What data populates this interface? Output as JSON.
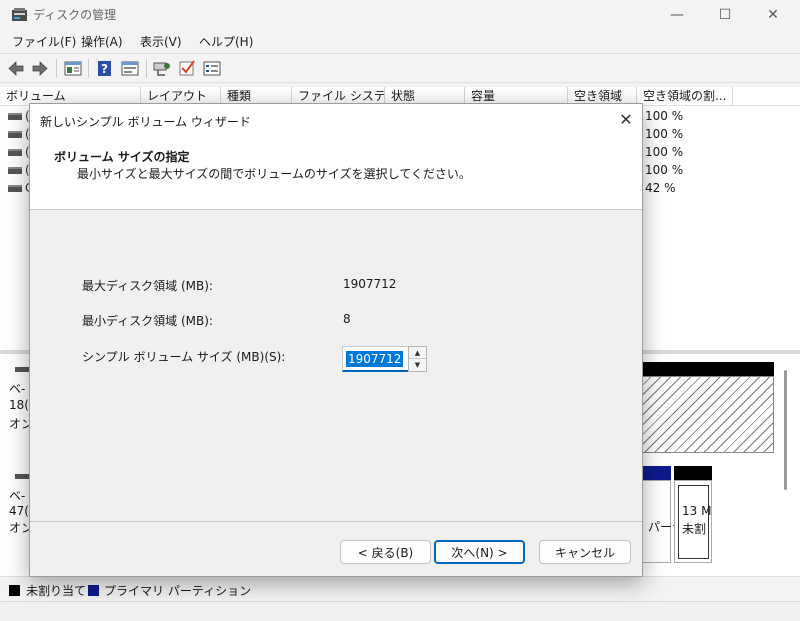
{
  "window": {
    "title": "ディスクの管理",
    "controls": {
      "minimize": "—",
      "maximize": "☐",
      "close": "✕"
    }
  },
  "menu": [
    "ファイル(F)",
    "操作(A)",
    "表示(V)",
    "ヘルプ(H)"
  ],
  "toolbar": {
    "icons": [
      "back-arrow-icon",
      "forward-arrow-icon",
      "disk-list-icon",
      "help-icon",
      "properties-icon",
      "connect-icon",
      "check-icon",
      "details-icon"
    ]
  },
  "volume_list": {
    "columns": [
      "ボリューム",
      "レイアウト",
      "種類",
      "ファイル システム",
      "状態",
      "容量",
      "空き領域",
      "空き領域の割..."
    ],
    "rows": [
      {
        "c": "(",
        "free_pct": "100 %"
      },
      {
        "c": "(",
        "free_pct": "100 %"
      },
      {
        "c": "(",
        "free_pct": "100 %"
      },
      {
        "c": "(",
        "free_pct": "100 %"
      },
      {
        "c": "C",
        "free_pct": "42 %"
      }
    ]
  },
  "disk_graphic": {
    "disk1": {
      "line1": "ベ-",
      "line2": "18(",
      "line3": "オン"
    },
    "disk2": {
      "line1": "ベ-",
      "line2": "47(",
      "line3": "オン"
    },
    "partition_fragment": "パーテ",
    "unalloc_fragment_1": "13 M",
    "unalloc_fragment_2": "未割"
  },
  "legend": {
    "items": [
      {
        "label": "未割り当て",
        "color": "#000000"
      },
      {
        "label": "プライマリ パーティション",
        "color": "#0d1a8c"
      }
    ]
  },
  "dialog": {
    "title": "新しいシンプル ボリューム ウィザード",
    "close": "✕",
    "heading": "ボリューム サイズの指定",
    "subheading": "最小サイズと最大サイズの間でボリュームのサイズを選択してください。",
    "fields": {
      "max_label": "最大ディスク領域 (MB):",
      "max_value": "1907712",
      "min_label": "最小ディスク領域 (MB):",
      "min_value": "8",
      "size_label": "シンプル ボリューム サイズ (MB)(S):",
      "size_value": "1907712"
    },
    "buttons": {
      "back": "< 戻る(B)",
      "next": "次へ(N) >",
      "cancel": "キャンセル"
    }
  }
}
